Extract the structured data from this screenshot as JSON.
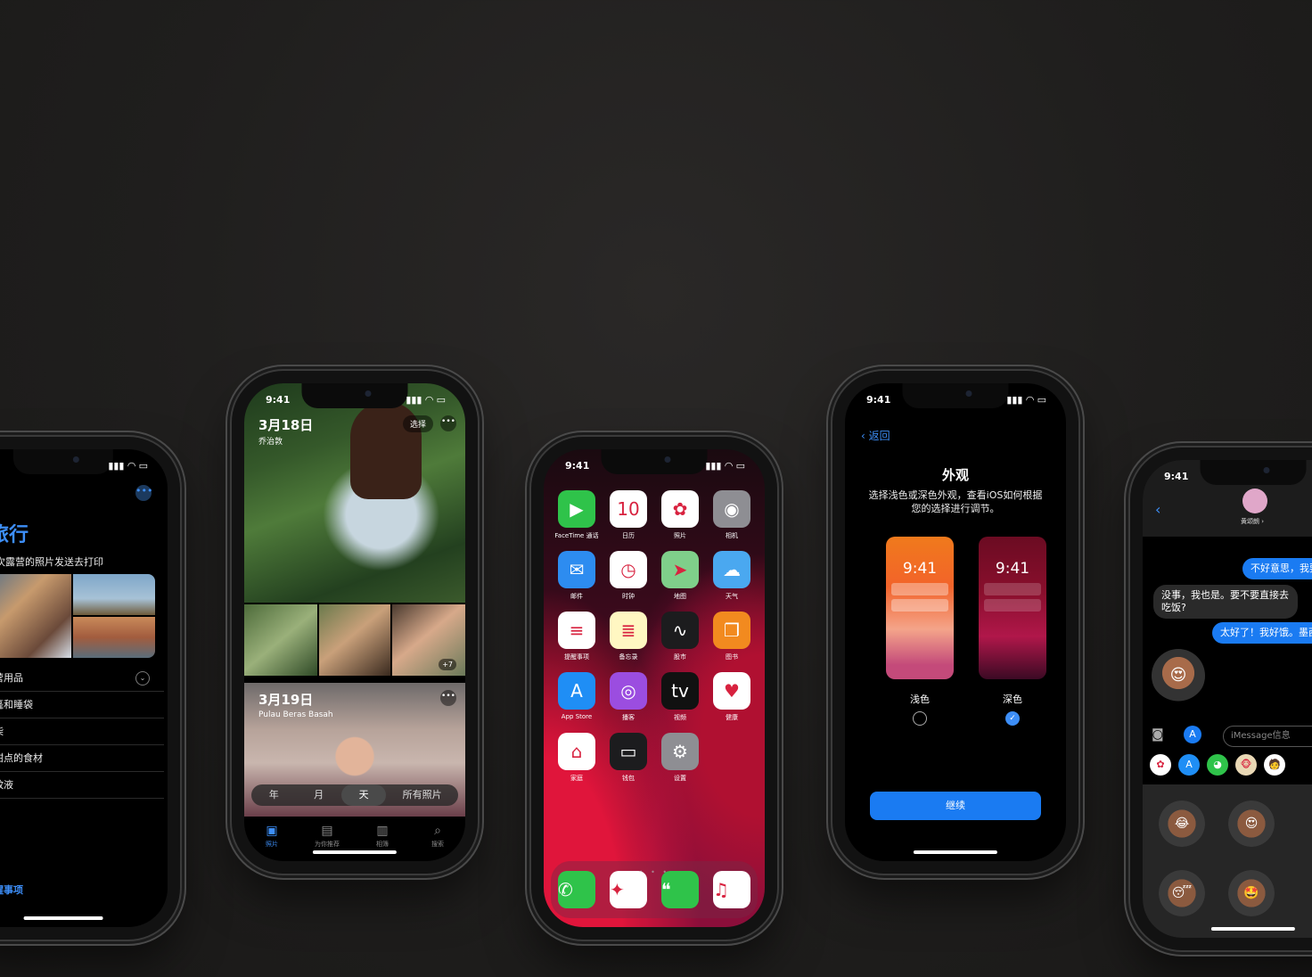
{
  "status_time": "9:41",
  "status_icons": "▮▮▮ ◠ ▭",
  "phone1": {
    "title": "旅行",
    "note": "一次露营的照片发送去打印",
    "more_glyph": "•••",
    "items": [
      "露营用品",
      "帐篷和睡袋",
      "木柴",
      "做甜点的食材",
      "防蚊液"
    ],
    "expand_glyph": "⌄",
    "footer": "提醒事项"
  },
  "phone2": {
    "date1": "3月18日",
    "subtitle1": "乔治敦",
    "select_label": "选择",
    "dots": "•••",
    "more_count": "+7",
    "date2": "3月19日",
    "subtitle2": "Pulau Beras Basah",
    "segments": [
      "年",
      "月",
      "天",
      "所有照片"
    ],
    "tabs": [
      {
        "icon": "▣",
        "label": "照片"
      },
      {
        "icon": "▤",
        "label": "为你推荐"
      },
      {
        "icon": "▥",
        "label": "相簿"
      },
      {
        "icon": "⌕",
        "label": "搜索"
      }
    ]
  },
  "phone3": {
    "apps": [
      {
        "label": "FaceTime 通话",
        "glyph": "▶",
        "color": "#2fc34a"
      },
      {
        "label": "日历",
        "glyph": "10",
        "color": "#ffffff"
      },
      {
        "label": "照片",
        "glyph": "✿",
        "color": "#ffffff"
      },
      {
        "label": "相机",
        "glyph": "◉",
        "color": "#8e8e93"
      },
      {
        "label": "邮件",
        "glyph": "✉",
        "color": "#2d8cf0"
      },
      {
        "label": "时钟",
        "glyph": "◷",
        "color": "#ffffff"
      },
      {
        "label": "地图",
        "glyph": "➤",
        "color": "#7fcf8a"
      },
      {
        "label": "天气",
        "glyph": "☁",
        "color": "#4aa8f0"
      },
      {
        "label": "提醒事项",
        "glyph": "≡",
        "color": "#ffffff"
      },
      {
        "label": "备忘录",
        "glyph": "≣",
        "color": "#fff7c2"
      },
      {
        "label": "股市",
        "glyph": "∿",
        "color": "#1c1c1e"
      },
      {
        "label": "图书",
        "glyph": "❐",
        "color": "#f28a1f"
      },
      {
        "label": "App Store",
        "glyph": "A",
        "color": "#1f8ef5"
      },
      {
        "label": "播客",
        "glyph": "◎",
        "color": "#9b4de0"
      },
      {
        "label": "视频",
        "glyph": "tv",
        "color": "#111111"
      },
      {
        "label": "健康",
        "glyph": "♥",
        "color": "#ffffff"
      },
      {
        "label": "家庭",
        "glyph": "⌂",
        "color": "#ffffff"
      },
      {
        "label": "钱包",
        "glyph": "▭",
        "color": "#1c1c1e"
      },
      {
        "label": "设置",
        "glyph": "⚙",
        "color": "#8e8e93"
      }
    ],
    "page_dots": "• • •",
    "dock": [
      {
        "name": "phone",
        "glyph": "✆",
        "color": "#2fc34a"
      },
      {
        "name": "safari",
        "glyph": "✦",
        "color": "#ffffff"
      },
      {
        "name": "messages",
        "glyph": "❝",
        "color": "#2fc34a"
      },
      {
        "name": "music",
        "glyph": "♫",
        "color": "#ffffff"
      }
    ]
  },
  "phone4": {
    "back": "‹ 返回",
    "heading": "外观",
    "description": "选择浅色或深色外观，查看iOS如何根据您的选择进行调节。",
    "mock_time": "9:41",
    "light_label": "浅色",
    "dark_label": "深色",
    "check": "✓",
    "selected": "dark",
    "continue": "继续"
  },
  "phone5": {
    "back": "‹",
    "contact": "黄颂朗 ›",
    "messages": [
      {
        "from": "me",
        "text": "不好意思，我要"
      },
      {
        "from": "them",
        "text": "没事，我也是。要不要直接去吃饭?"
      },
      {
        "from": "me",
        "text": "太好了！我好饿。墨西哥"
      }
    ],
    "memoji": "😍",
    "camera": "◙",
    "appstore": "A",
    "placeholder": "iMessage信息",
    "strip": [
      {
        "glyph": "✿",
        "color": "#ffffff"
      },
      {
        "glyph": "A",
        "color": "#1f8ef5"
      },
      {
        "glyph": "◕",
        "color": "#2fc34a"
      },
      {
        "glyph": "🐵",
        "color": "#e9d8b5"
      },
      {
        "glyph": "🧑",
        "color": "#ffffff"
      }
    ],
    "stickers": [
      "😂",
      "😍",
      "😴",
      "🤩"
    ]
  }
}
